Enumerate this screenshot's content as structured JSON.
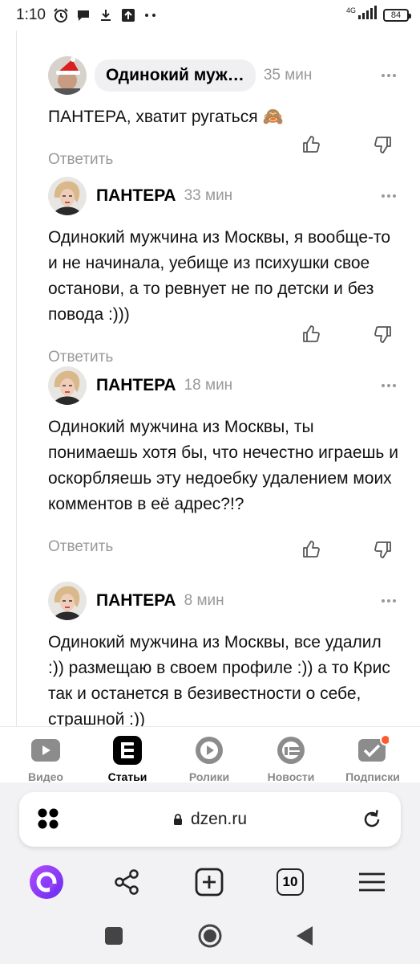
{
  "status_bar": {
    "time": "1:10",
    "network": "4G",
    "battery": "84",
    "icons": [
      "alarm-icon",
      "chat-bubble-icon",
      "download-icon",
      "upload-icon",
      "more-dots-icon",
      "signal-icon",
      "battery-icon"
    ]
  },
  "comments": [
    {
      "author": "Одинокий муж…",
      "time": "35 мин",
      "text": "ПАНТЕРА, хватит ругаться 🙈",
      "reply_label": "Ответить",
      "avatar": "santa-hat-avatar"
    },
    {
      "author": "ПАНТЕРА",
      "time": "33 мин",
      "text": "Одинокий мужчина из Москвы, я вообще-то и не начинала, уебище из психушки свое останови, а то ревнует не по детски и без повода :)))",
      "reply_label": "Ответить",
      "avatar": "woman-avatar"
    },
    {
      "author": "ПАНТЕРА",
      "time": "18 мин",
      "text": "Одинокий мужчина из Москвы, ты понимаешь хотя бы, что нечестно играешь и оскорбляешь эту недоебку удалением моих комментов в её адрес?!?",
      "reply_label": "Ответить",
      "avatar": "woman-avatar"
    },
    {
      "author": "ПАНТЕРА",
      "time": "8 мин",
      "text": "Одинокий мужчина из Москвы, все удалил :)) размещаю в своем профиле :)) а то Крис так и останется в безивестности о себе, страшной :))",
      "avatar": "woman-avatar"
    }
  ],
  "tabs": [
    {
      "label": "Видео",
      "icon": "video-icon",
      "active": false
    },
    {
      "label": "Статьи",
      "icon": "articles-icon",
      "active": true
    },
    {
      "label": "Ролики",
      "icon": "clips-icon",
      "active": false
    },
    {
      "label": "Новости",
      "icon": "news-icon",
      "active": false
    },
    {
      "label": "Подписки",
      "icon": "subscriptions-icon",
      "active": false
    }
  ],
  "browser": {
    "url": "dzen.ru",
    "tab_count": "10",
    "accent": "#7b3ff2"
  },
  "colors": {
    "notification_dot": "#ff5b2e",
    "muted_text": "#999999"
  }
}
